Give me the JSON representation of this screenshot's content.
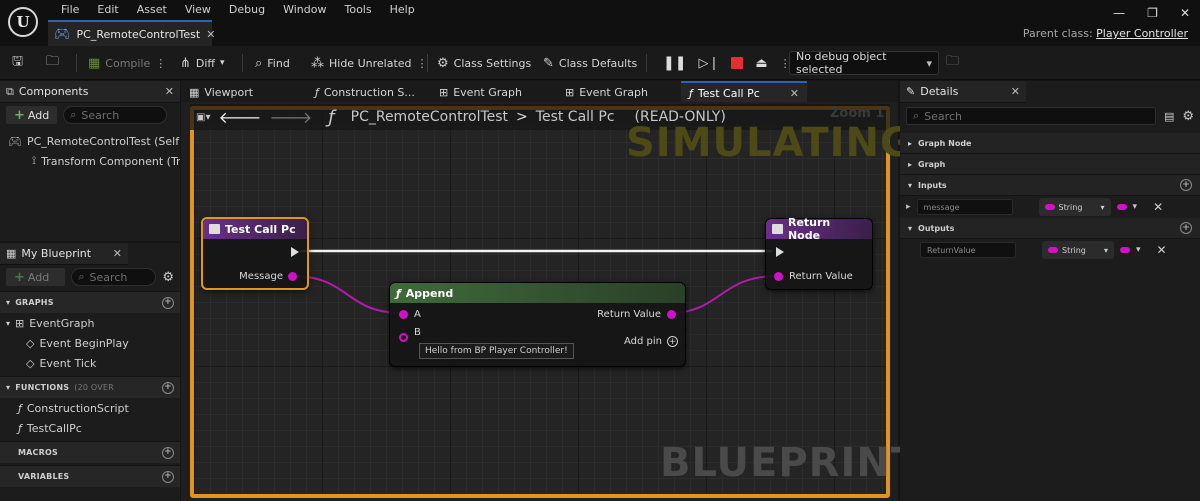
{
  "app": {
    "menu": [
      "File",
      "Edit",
      "Asset",
      "View",
      "Debug",
      "Window",
      "Tools",
      "Help"
    ],
    "document_tab": "PC_RemoteControlTest",
    "parent_class_label": "Parent class:",
    "parent_class_value": "Player Controller",
    "logo_letter": "U"
  },
  "toolbar": {
    "compile": "Compile",
    "diff": "Diff",
    "find": "Find",
    "hide_unrelated": "Hide Unrelated",
    "class_settings": "Class Settings",
    "class_defaults": "Class Defaults",
    "debug_object": "No debug object selected",
    "stop_color": "#e03030"
  },
  "components": {
    "tab": "Components",
    "add": "Add",
    "search_placeholder": "Search",
    "items": [
      "PC_RemoteControlTest (Self)",
      "Transform Component (Tra"
    ]
  },
  "my_blueprint": {
    "tab": "My Blueprint",
    "add": "Add",
    "search_placeholder": "Search",
    "graphs_header": "GRAPHS",
    "event_graph": "EventGraph",
    "events": [
      "Event BeginPlay",
      "Event Tick"
    ],
    "functions_header": "FUNCTIONS",
    "functions_sub": "(20 OVER",
    "functions": [
      "ConstructionScript",
      "TestCallPc"
    ],
    "macros_header": "MACROS",
    "variables_header": "VARIABLES"
  },
  "graph_tabs": [
    "Viewport",
    "Construction S...",
    "Event Graph",
    "Event Graph",
    "Test Call Pc"
  ],
  "graph": {
    "breadcrumb_parent": "PC_RemoteControlTest",
    "breadcrumb_sep": ">",
    "breadcrumb_current": "Test Call Pc",
    "readonly": "(READ-ONLY)",
    "zoom": "Zoom 1",
    "simulating": "SIMULATING",
    "watermark": "BLUEPRINT",
    "frame_color": "#e1951a",
    "nodes": {
      "entry": {
        "title": "Test Call Pc",
        "pin_message": "Message",
        "head_color": "#6a2f8a"
      },
      "return": {
        "title": "Return Node",
        "pin_value": "Return Value",
        "head_color": "#6a2f8a"
      },
      "append": {
        "title": "Append",
        "pin_a": "A",
        "pin_b": "B",
        "b_default": "Hello from BP Player Controller!",
        "out": "Return Value",
        "add_pin": "Add pin",
        "head_color": "#3f6b3a"
      }
    }
  },
  "details": {
    "tab": "Details",
    "search_placeholder": "Search",
    "sections": [
      "Graph Node",
      "Graph",
      "Inputs",
      "Outputs"
    ],
    "input_name": "message",
    "input_type": "String",
    "output_name": "ReturnValue",
    "output_type": "String"
  }
}
